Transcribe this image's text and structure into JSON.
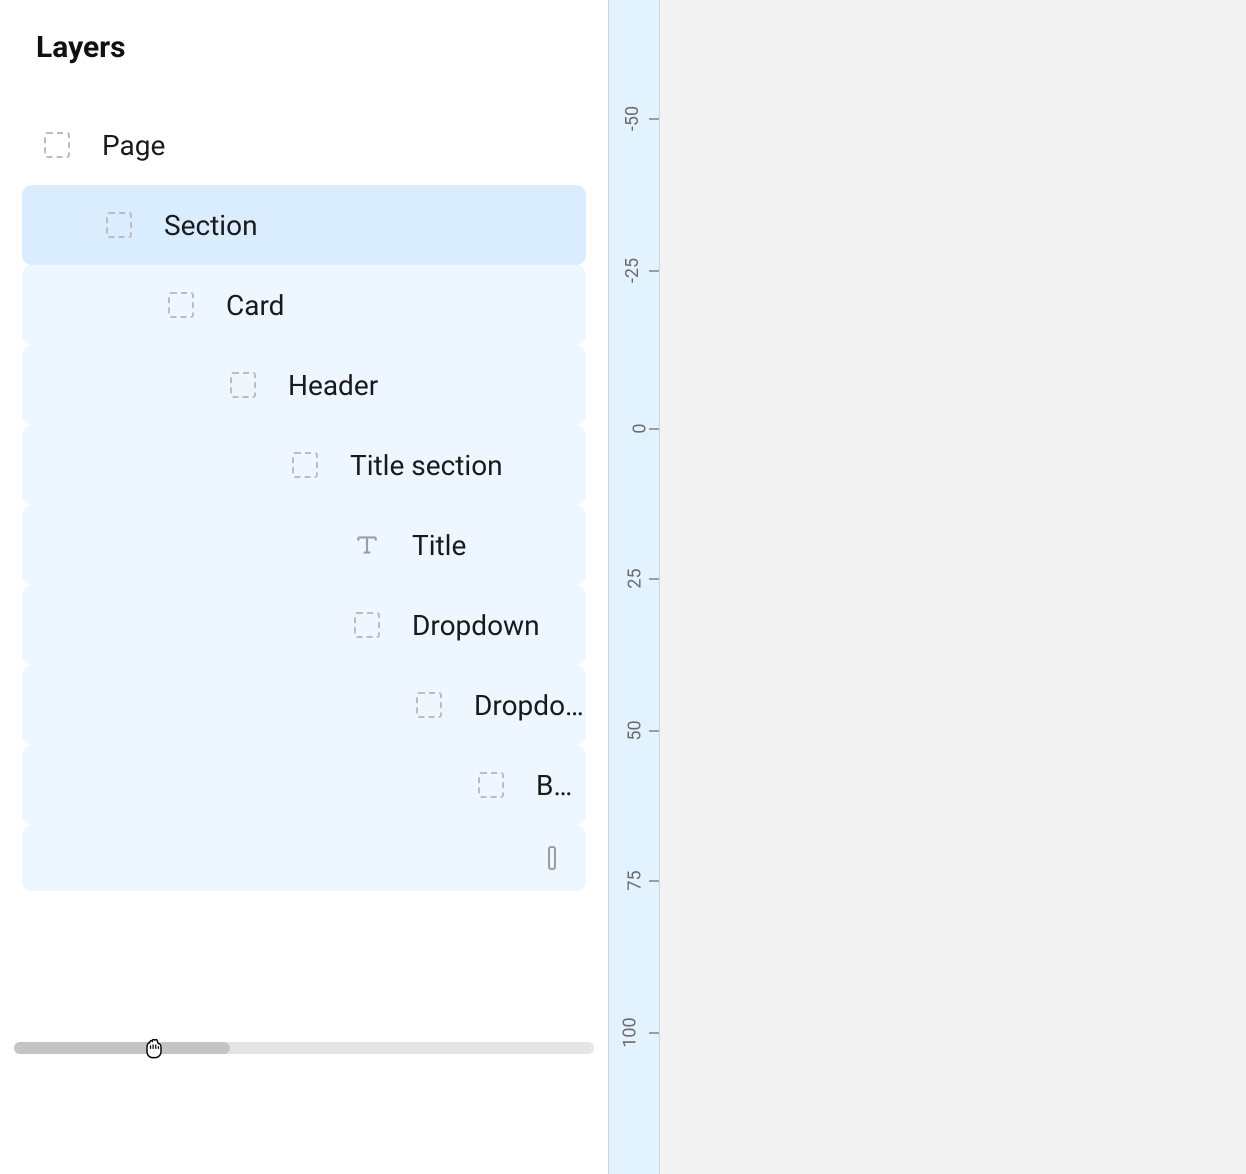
{
  "panel": {
    "title": "Layers"
  },
  "layers": [
    {
      "label": "Page",
      "indent": 0,
      "icon": "frame",
      "state": "normal"
    },
    {
      "label": "Section",
      "indent": 1,
      "icon": "frame",
      "state": "selected"
    },
    {
      "label": "Card",
      "indent": 2,
      "icon": "frame",
      "state": "child"
    },
    {
      "label": "Header",
      "indent": 3,
      "icon": "frame",
      "state": "child"
    },
    {
      "label": "Title section",
      "indent": 4,
      "icon": "frame",
      "state": "child"
    },
    {
      "label": "Title",
      "indent": 5,
      "icon": "text",
      "state": "child"
    },
    {
      "label": "Dropdown",
      "indent": 5,
      "icon": "frame",
      "state": "child"
    },
    {
      "label": "Dropdo…",
      "indent": 6,
      "icon": "frame",
      "state": "child"
    },
    {
      "label": "Bu…",
      "indent": 7,
      "icon": "frame",
      "state": "child"
    },
    {
      "label": "",
      "indent": 7,
      "icon": "scrollhint",
      "state": "child"
    }
  ],
  "ruler": {
    "ticks": [
      {
        "value": "-50",
        "pos": 118
      },
      {
        "value": "-25",
        "pos": 270
      },
      {
        "value": "0",
        "pos": 426
      },
      {
        "value": "25",
        "pos": 578
      },
      {
        "value": "50",
        "pos": 730
      },
      {
        "value": "75",
        "pos": 880
      },
      {
        "value": "100",
        "pos": 1032
      }
    ]
  }
}
